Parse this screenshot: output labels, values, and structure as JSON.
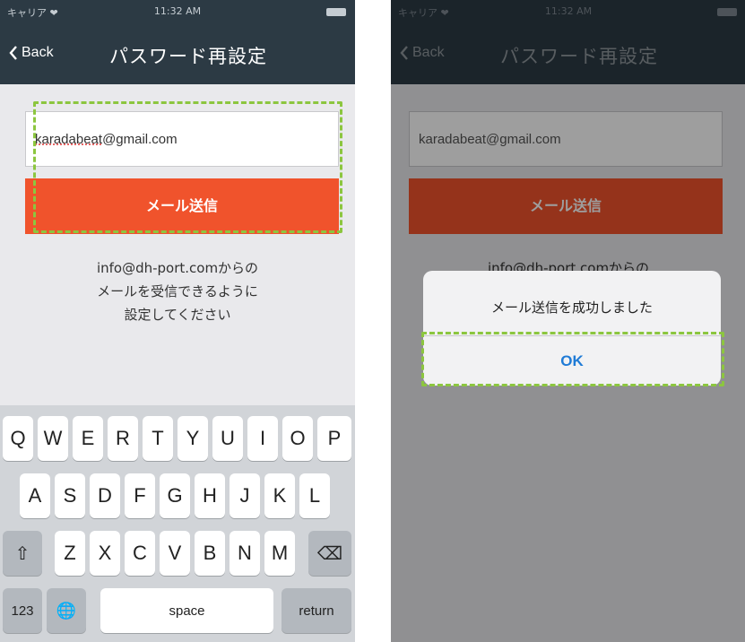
{
  "status": {
    "carrier": "キャリア ❤",
    "time": "11:32 AM"
  },
  "nav": {
    "back": "Back",
    "title": "パスワード再設定"
  },
  "form": {
    "email_user": "karadabeat",
    "email_domain": "@gmail.com",
    "email_full": "karadabeat@gmail.com",
    "send_label": "メール送信",
    "info_lines": [
      "info@dh-port.comからの",
      "メールを受信できるように",
      "設定してください"
    ]
  },
  "keyboard": {
    "row1": [
      "Q",
      "W",
      "E",
      "R",
      "T",
      "Y",
      "U",
      "I",
      "O",
      "P"
    ],
    "row2": [
      "A",
      "S",
      "D",
      "F",
      "G",
      "H",
      "J",
      "K",
      "L"
    ],
    "row3": [
      "Z",
      "X",
      "C",
      "V",
      "B",
      "N",
      "M"
    ],
    "shift": "⇧",
    "delete": "⌫",
    "numbers": "123",
    "globe": "🌐",
    "space": "space",
    "return": "return"
  },
  "alert": {
    "message": "メール送信を成功しました",
    "ok": "OK"
  },
  "colors": {
    "navbar": "#2c3a44",
    "send_button": "#f0532c",
    "highlight": "#8cc63f",
    "ok_text": "#1f7bd6"
  }
}
